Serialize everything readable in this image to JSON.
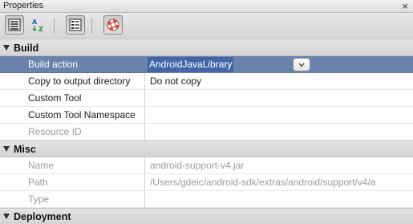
{
  "window": {
    "title": "Properties"
  },
  "toolbar": {
    "buttons": [
      {
        "icon": "categorized-view-icon",
        "pressed": true
      },
      {
        "icon": "sort-alphabetical-icon",
        "pressed": false
      },
      {
        "icon": "property-pages-icon",
        "pressed": true
      },
      {
        "icon": "help-lifebuoy-icon",
        "pressed": true
      }
    ]
  },
  "categories": [
    {
      "label": "Build",
      "rows": [
        {
          "name": "Build action",
          "value": "AndroidJavaLibrary",
          "selected": true,
          "disabled": false
        },
        {
          "name": "Copy to output directory",
          "value": "Do not copy",
          "selected": false,
          "disabled": false
        },
        {
          "name": "Custom Tool",
          "value": "",
          "selected": false,
          "disabled": false
        },
        {
          "name": "Custom Tool Namespace",
          "value": "",
          "selected": false,
          "disabled": false
        },
        {
          "name": "Resource ID",
          "value": "",
          "selected": false,
          "disabled": true
        }
      ]
    },
    {
      "label": "Misc",
      "rows": [
        {
          "name": "Name",
          "value": "android-support-v4.jar",
          "selected": false,
          "disabled": true
        },
        {
          "name": "Path",
          "value": "/Users/gdeic/android-sdk/extras/android/support/v4/a",
          "selected": false,
          "disabled": true
        },
        {
          "name": "Type",
          "value": "",
          "selected": false,
          "disabled": true
        }
      ]
    },
    {
      "label": "Deployment",
      "rows": []
    }
  ]
}
